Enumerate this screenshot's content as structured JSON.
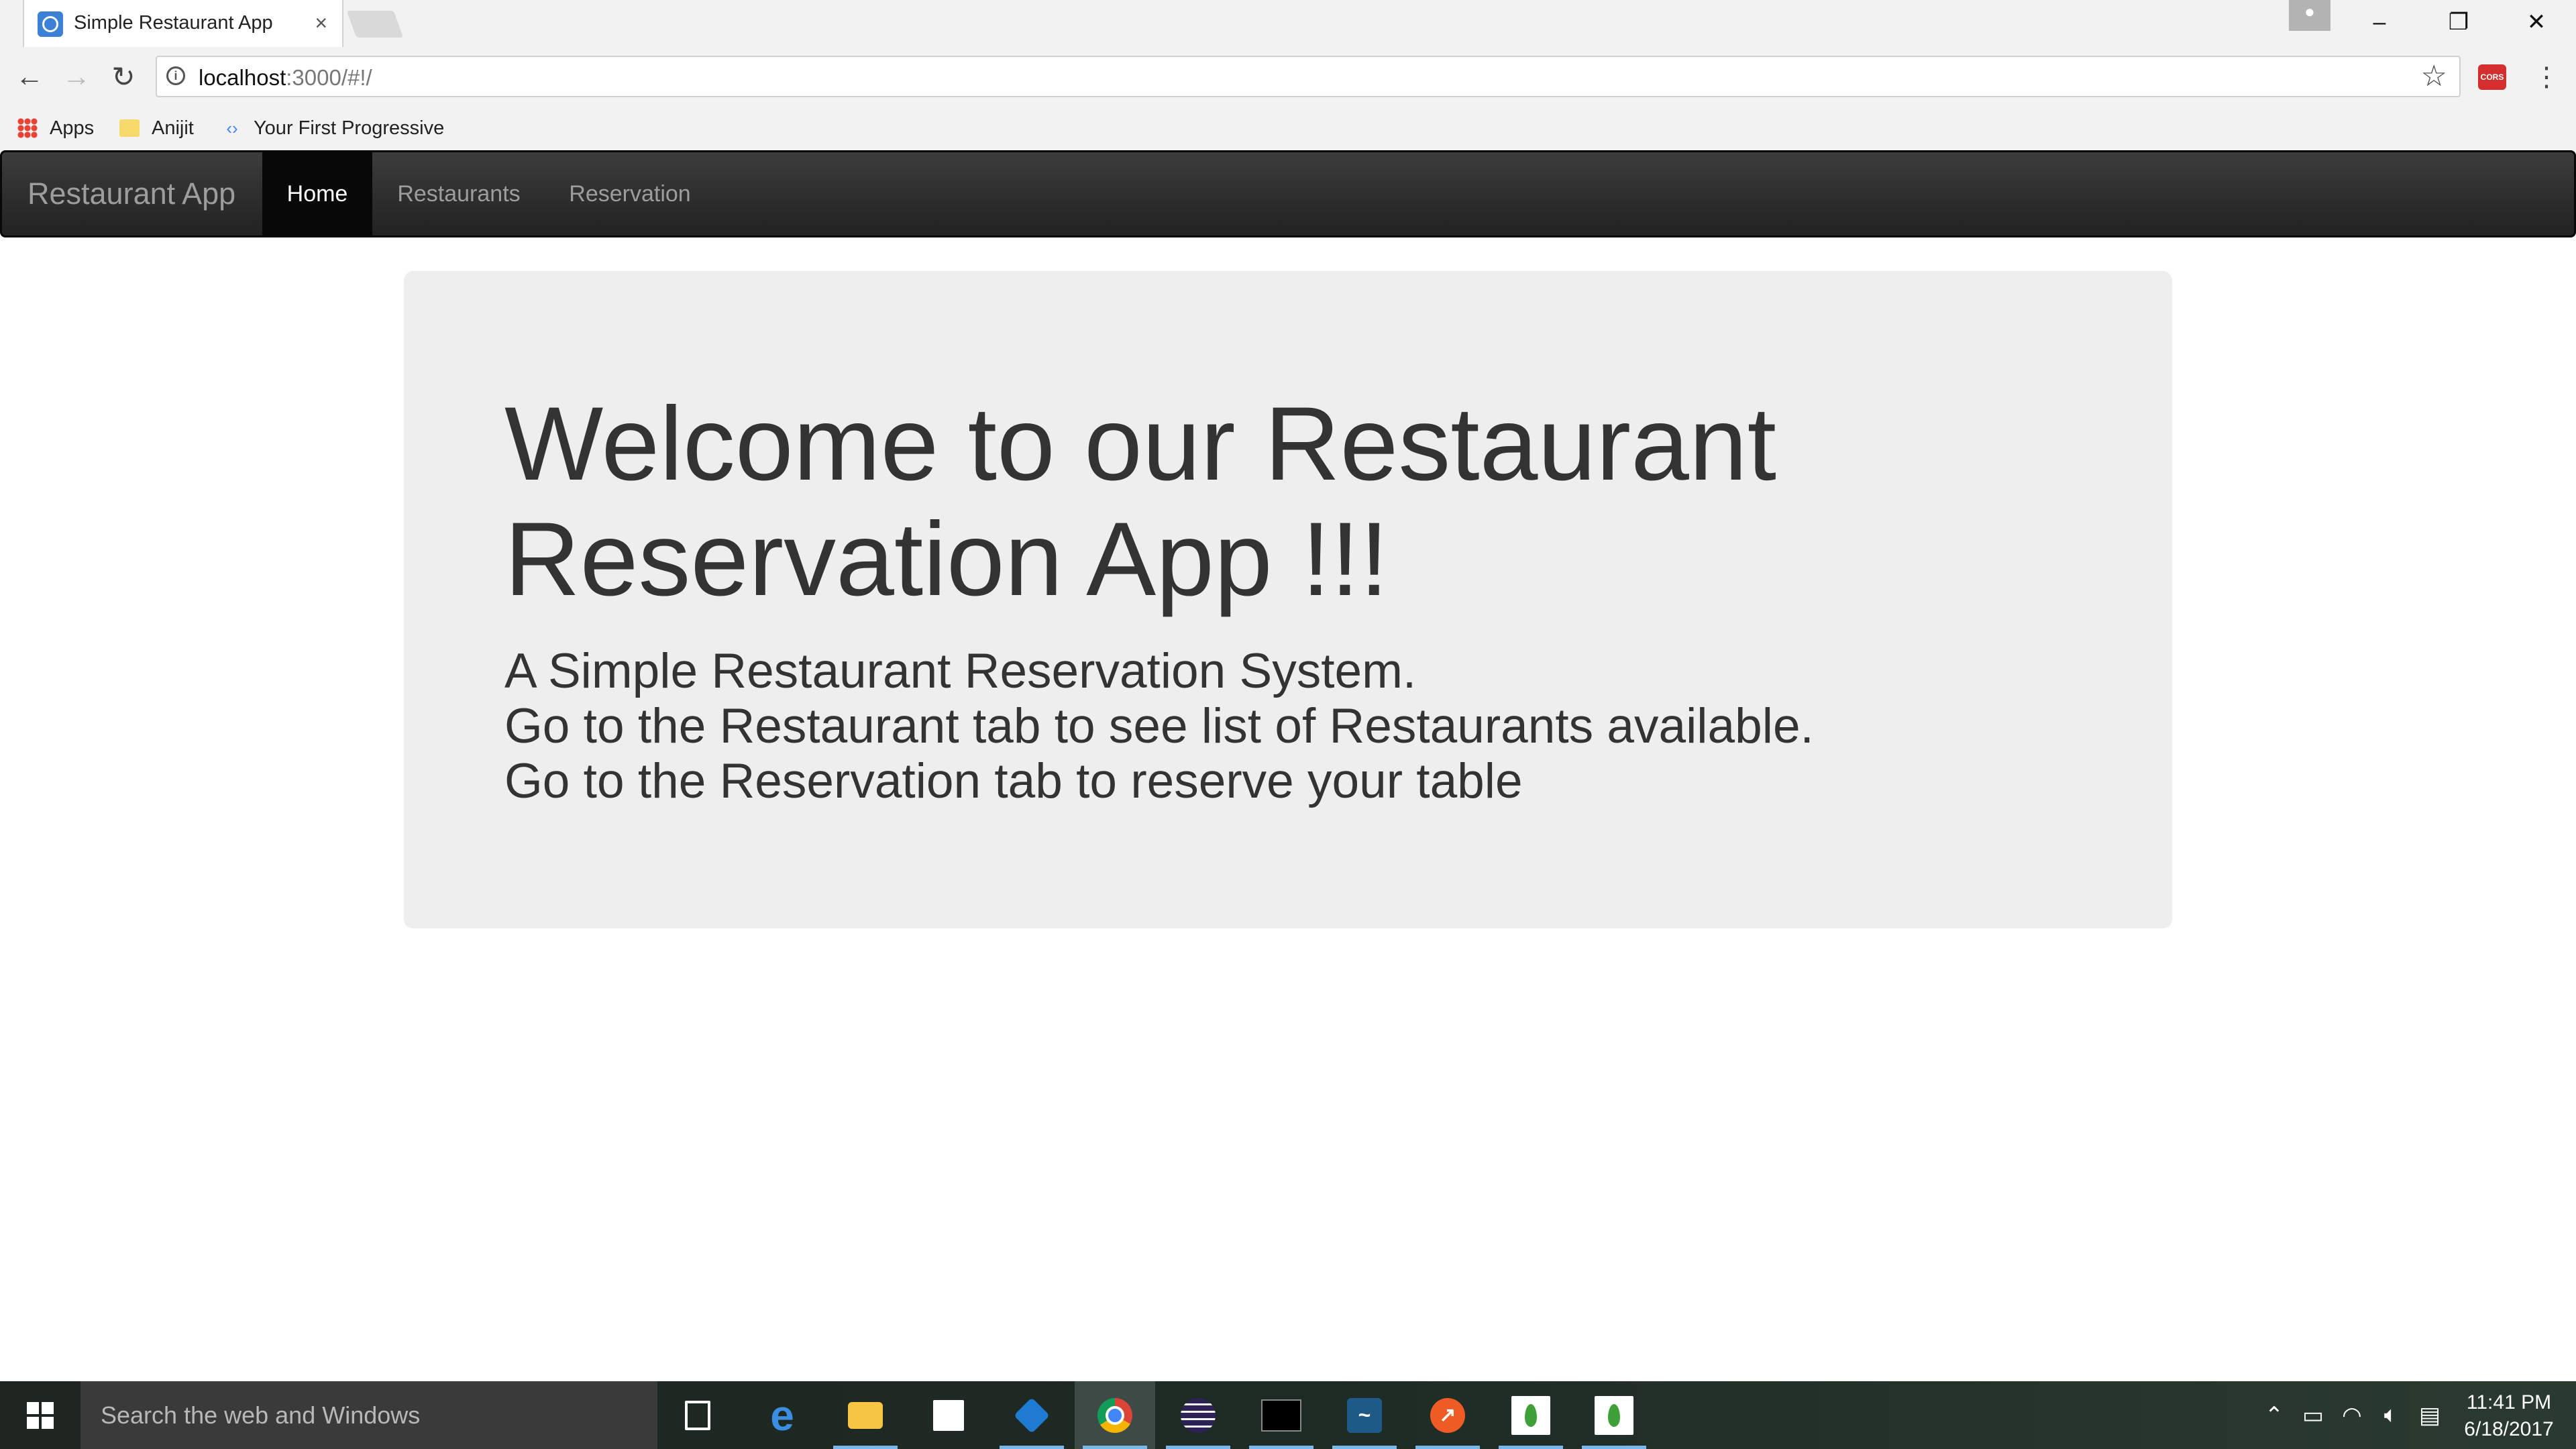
{
  "browser": {
    "tab": {
      "title": "Simple Restaurant App",
      "close": "×"
    },
    "window_controls": {
      "minimize": "–",
      "restore": "❐",
      "close": "✕"
    },
    "nav": {
      "back": "←",
      "forward": "→",
      "reload": "↻"
    },
    "address": {
      "host": "localhost",
      "rest": ":3000/#!/"
    },
    "extension_label": "CORS",
    "bookmarks": [
      {
        "label": "Apps",
        "icon": "apps-grid-icon"
      },
      {
        "label": "Anijit",
        "icon": "folder-icon"
      },
      {
        "label": "Your First Progressive",
        "icon": "pwa-icon"
      }
    ]
  },
  "navbar": {
    "brand": "Restaurant App",
    "items": [
      {
        "label": "Home",
        "active": true
      },
      {
        "label": "Restaurants",
        "active": false
      },
      {
        "label": "Reservation",
        "active": false
      }
    ]
  },
  "jumbotron": {
    "title": "Welcome to our Restaurant Reservation App !!!",
    "lines": [
      "A Simple Restaurant Reservation System.",
      "Go to the Restaurant tab to see list of Restaurants available.",
      "Go to the Reservation tab to reserve your table"
    ]
  },
  "taskbar": {
    "search_placeholder": "Search the web and Windows",
    "clock_time": "11:41 PM",
    "clock_date": "6/18/2017",
    "pinned_apps": [
      "task-view",
      "edge",
      "file-explorer",
      "store",
      "visual-studio-code",
      "chrome",
      "eclipse",
      "command-prompt",
      "mysql-workbench",
      "postman",
      "mongodb",
      "mongodb"
    ]
  },
  "colors": {
    "navbar_bg": "#222222",
    "navbar_active": "#080808",
    "jumbotron_bg": "#eeeeee",
    "text": "#333333"
  }
}
